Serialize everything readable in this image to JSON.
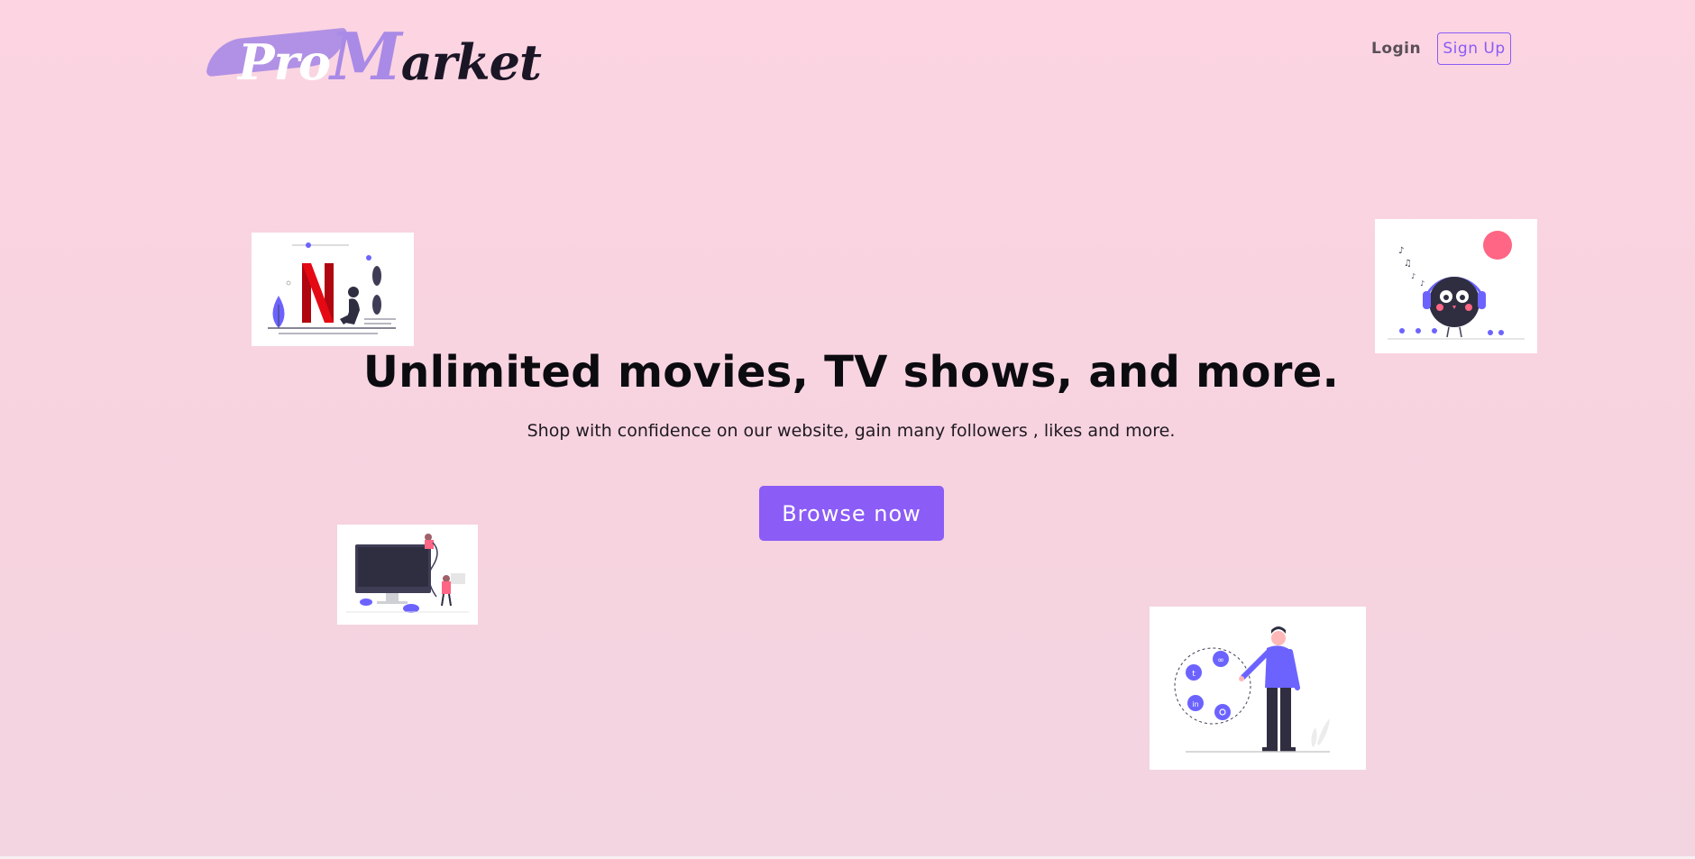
{
  "brand": {
    "logo_text": "ProMarket",
    "accent": "#8b5cf6",
    "brush": "#a98ae6"
  },
  "nav": {
    "login_label": "Login",
    "signup_label": "Sign Up"
  },
  "hero": {
    "headline": "Unlimited movies, TV shows, and more.",
    "subtitle": "Shop with confidence on our website, gain many followers , likes and more.",
    "cta_label": "Browse now"
  },
  "illustrations": [
    {
      "icon": "netflix-illustration-icon"
    },
    {
      "icon": "music-bird-illustration-icon"
    },
    {
      "icon": "computer-repair-illustration-icon"
    },
    {
      "icon": "social-media-illustration-icon"
    }
  ]
}
